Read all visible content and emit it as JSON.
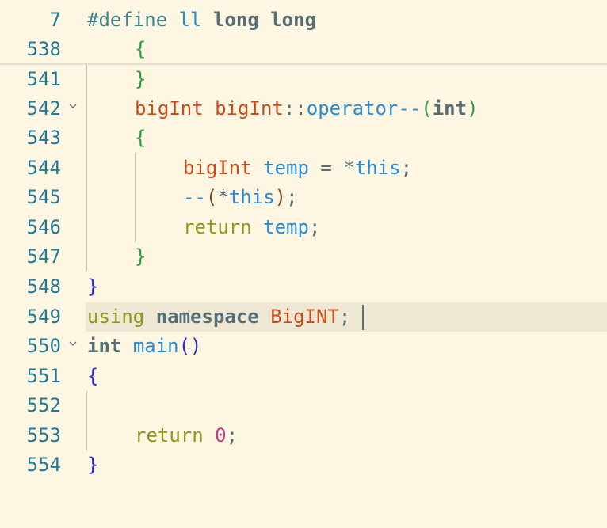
{
  "editor": {
    "colors": {
      "background": "#fdf6e3",
      "line_number": "#237893",
      "current_line": "#eee8d5"
    },
    "sticky": {
      "line7": {
        "num": "7",
        "define": "#define",
        "ll": "ll",
        "long1": "long",
        "long2": "long"
      },
      "line538": {
        "num": "538",
        "brace": "{"
      }
    },
    "lines": {
      "l541": {
        "num": "541",
        "brace": "}"
      },
      "l542": {
        "num": "542",
        "type": "bigInt",
        "scope": "bigInt",
        "sep": "::",
        "op": "operator--",
        "lp": "(",
        "int": "int",
        "rp": ")"
      },
      "l543": {
        "num": "543",
        "brace": "{"
      },
      "l544": {
        "num": "544",
        "type": "bigInt",
        "var": "temp",
        "eq": " = ",
        "star": "*",
        "this": "this",
        "semi": ";"
      },
      "l545": {
        "num": "545",
        "dec": "--",
        "lp": "(",
        "star": "*",
        "this": "this",
        "rp": ")",
        "semi": ";"
      },
      "l546": {
        "num": "546",
        "ret": "return",
        "var": "temp",
        "semi": ";"
      },
      "l547": {
        "num": "547",
        "brace": "}"
      },
      "l548": {
        "num": "548",
        "brace": "}"
      },
      "l549": {
        "num": "549",
        "using": "using",
        "namespace": "namespace",
        "name": "BigINT",
        "semi": ";"
      },
      "l550": {
        "num": "550",
        "int": "int",
        "fn": "main",
        "parens": "()"
      },
      "l551": {
        "num": "551",
        "brace": "{"
      },
      "l552": {
        "num": "552"
      },
      "l553": {
        "num": "553",
        "ret": "return",
        "zero": "0",
        "semi": ";"
      },
      "l554": {
        "num": "554",
        "brace": "}"
      }
    },
    "fold_icon": "chevron-down-icon"
  }
}
